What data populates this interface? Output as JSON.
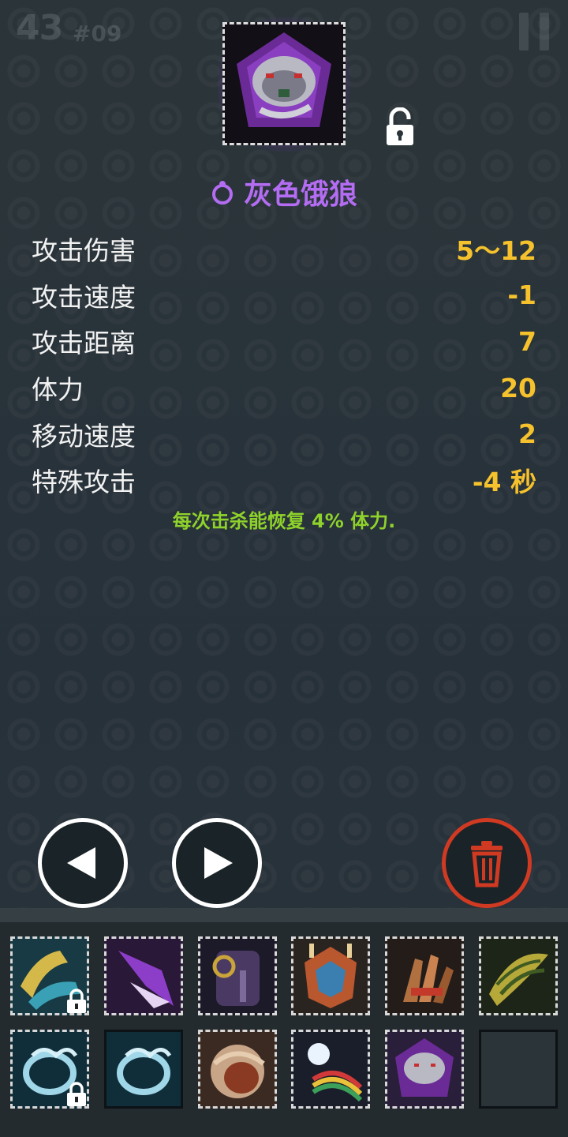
{
  "hud": {
    "score": "43",
    "stage": "#09"
  },
  "item": {
    "name": "灰色饿狼",
    "icon": "gray-wolf-item-icon",
    "lock_icon": "unlocked-padlock-icon"
  },
  "stats": [
    {
      "label": "攻击伤害",
      "value": "5～12"
    },
    {
      "label": "攻击速度",
      "value": "-1"
    },
    {
      "label": "攻击距离",
      "value": "7"
    },
    {
      "label": "体力",
      "value": "20"
    },
    {
      "label": "移动速度",
      "value": "2"
    },
    {
      "label": "特殊攻击",
      "value": "-4 秒"
    }
  ],
  "description": "每次击杀能恢复 4% 体力.",
  "controls": {
    "prev_icon": "triangle-left-icon",
    "next_icon": "triangle-right-icon",
    "delete_icon": "trash-icon"
  },
  "colors": {
    "item_name": "#b36cf2",
    "stat_value": "#f5c22d",
    "description": "#8fd22b",
    "delete_accent": "#d13a22"
  },
  "inventory": [
    {
      "icon": "golden-claw-icon",
      "locked": true
    },
    {
      "icon": "purple-blade-icon",
      "locked": false
    },
    {
      "icon": "dark-armor-icon",
      "locked": false
    },
    {
      "icon": "spiked-shield-icon",
      "locked": false
    },
    {
      "icon": "bronze-gauntlet-icon",
      "locked": false
    },
    {
      "icon": "feathered-wing-icon",
      "locked": false
    },
    {
      "icon": "blue-ring-icon",
      "locked": true
    },
    {
      "icon": "blue-ring-icon",
      "locked": false
    },
    {
      "icon": "leather-pouch-icon",
      "locked": false
    },
    {
      "icon": "rainbow-orb-icon",
      "locked": false
    },
    {
      "icon": "gray-wolf-item-icon",
      "locked": false
    },
    {
      "icon": "empty-slot",
      "locked": false
    }
  ]
}
